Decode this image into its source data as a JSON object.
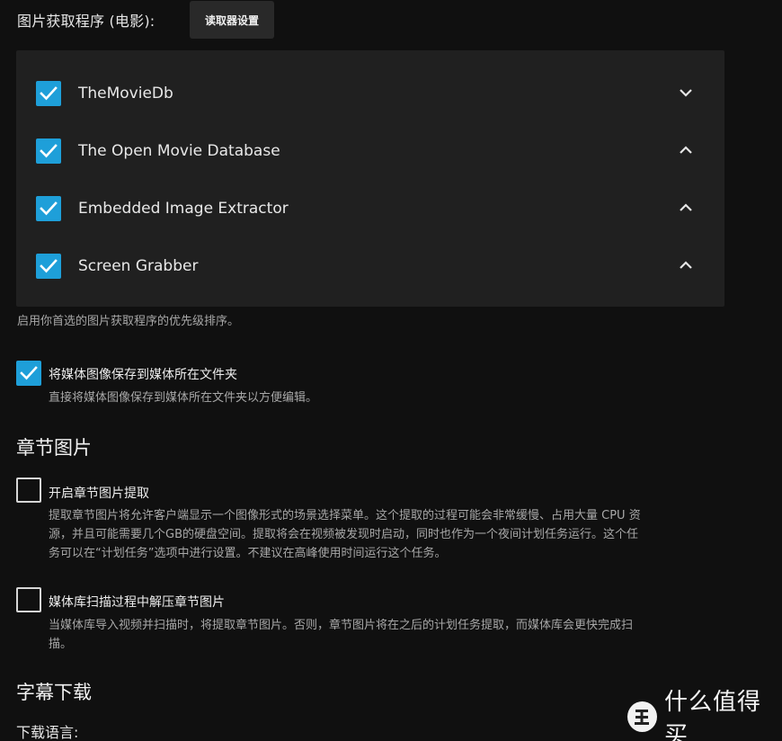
{
  "image_fetchers": {
    "label": "图片获取程序 (电影):",
    "reader_settings_button": "读取器设置",
    "items": [
      {
        "name": "TheMovieDb",
        "checked": true,
        "chevron": "chevron-down-icon"
      },
      {
        "name": "The Open Movie Database",
        "checked": true,
        "chevron": "chevron-up-icon"
      },
      {
        "name": "Embedded Image Extractor",
        "checked": true,
        "chevron": "chevron-up-icon"
      },
      {
        "name": "Screen Grabber",
        "checked": true,
        "chevron": "chevron-up-icon"
      }
    ],
    "hint": "启用你首选的图片获取程序的优先级排序。"
  },
  "save_local": {
    "checked": true,
    "label": "将媒体图像保存到媒体所在文件夹",
    "description": "直接将媒体图像保存到媒体所在文件夹以方便编辑。"
  },
  "chapter_images": {
    "title": "章节图片",
    "extract": {
      "checked": false,
      "label": "开启章节图片提取",
      "description_lines": [
        "提取章节图片将允许客户端显示一个图像形式的场景选择菜单。这个提取的过程可能会非常缓慢、占用大量 CPU 资",
        "源，并且可能需要几个GB的硬盘空间。提取将会在视频被发现时启动，同时也作为一个夜间计划任务运行。这个任",
        "务可以在“计划任务”选项中进行设置。不建议在高峰使用时间运行这个任务。"
      ]
    },
    "during_scan": {
      "checked": false,
      "label": "媒体库扫描过程中解压章节图片",
      "description_lines": [
        "当媒体库导入视频并扫描时，将提取章节图片。否则，章节图片将在之后的计划任务提取，而媒体库会更快完成扫",
        "描。"
      ]
    }
  },
  "subtitle_download": {
    "title": "字幕下载",
    "language_label": "下载语言:"
  },
  "watermark": {
    "logo_glyph": "值",
    "text": "什么值得买"
  },
  "colors": {
    "accent": "#1e9fd9",
    "background": "#101010",
    "panel": "#202020",
    "button": "#292929"
  }
}
